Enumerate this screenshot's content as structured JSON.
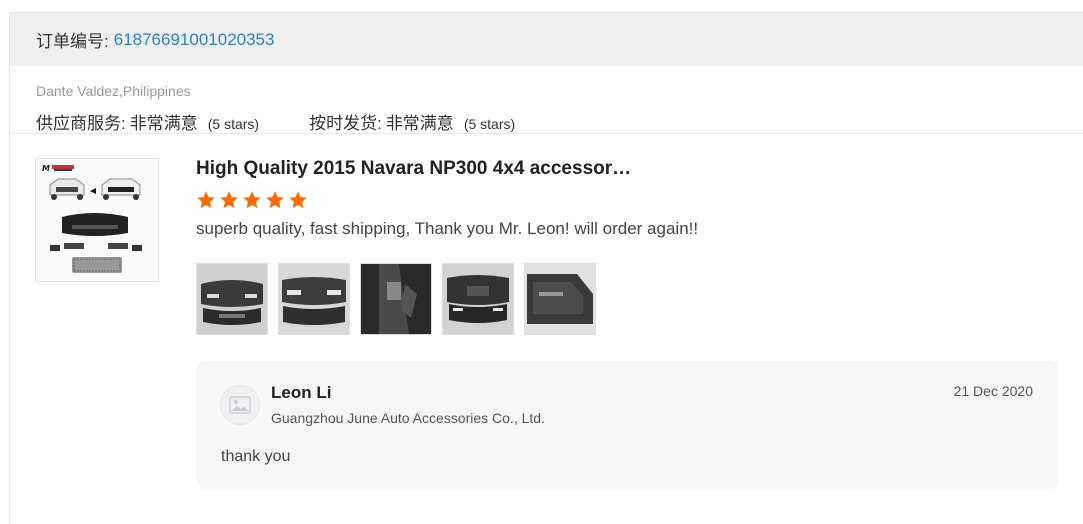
{
  "order": {
    "label": "订单编号:",
    "number": "61876691001020353"
  },
  "buyer": {
    "name": "Dante Valdez,Philippines",
    "ratings": [
      {
        "label": "供应商服务:",
        "value": "非常满意",
        "stars": "(5 stars)"
      },
      {
        "label": "按时发货:",
        "value": "非常满意",
        "stars": "(5 stars)"
      }
    ]
  },
  "review": {
    "product_title": "High Quality 2015 Navara NP300 4x4 accessor…",
    "rating": 5,
    "star_color": "#ff6a00",
    "comment": "superb quality, fast shipping, Thank you Mr. Leon! will order again!!",
    "photo_count": 5
  },
  "reply": {
    "name": "Leon Li",
    "company": "Guangzhou June Auto Accessories Co., Ltd.",
    "date": "21 Dec 2020",
    "text": "thank you"
  },
  "colors": {
    "link": "#2c82c9",
    "star": "#ff6a00",
    "reply_bg": "#f5f7f9"
  }
}
